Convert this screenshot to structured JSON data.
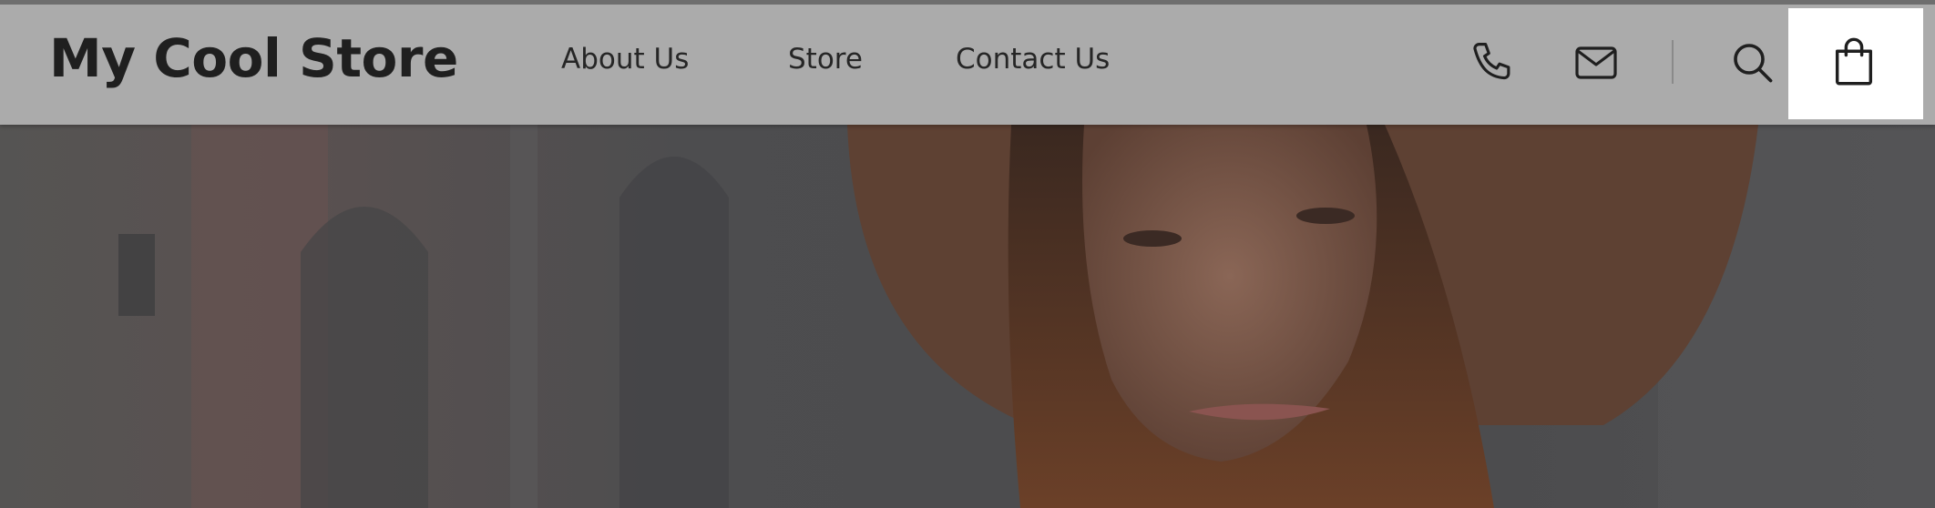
{
  "header": {
    "logo": "My Cool Store",
    "nav": [
      {
        "label": "About Us"
      },
      {
        "label": "Store"
      },
      {
        "label": "Contact Us"
      }
    ],
    "icons": {
      "phone": "phone-icon",
      "mail": "mail-icon",
      "search": "search-icon",
      "cart": "shopping-bag-icon"
    }
  },
  "hero": {
    "image": "woman-in-brown-hat-photo"
  },
  "colors": {
    "header_bg": "#ababab",
    "text": "#1f1f1f",
    "cart_highlight": "#ffffff"
  }
}
